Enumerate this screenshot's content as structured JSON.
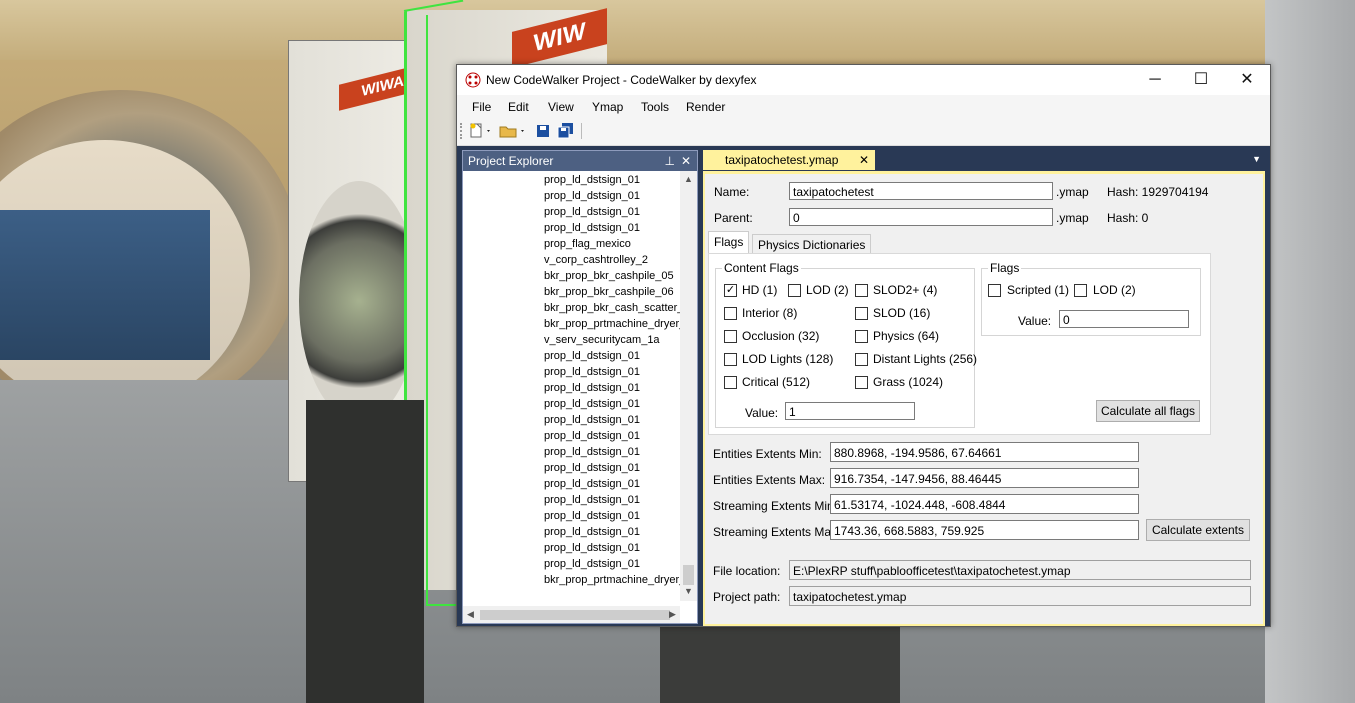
{
  "window": {
    "title": "New CodeWalker Project - CodeWalker by dexyfex",
    "controls": {
      "minimize": "─",
      "maximize": "☐",
      "close": "✕"
    }
  },
  "menu": [
    "File",
    "Edit",
    "View",
    "Ymap",
    "Tools",
    "Render"
  ],
  "explorer": {
    "title": "Project Explorer",
    "items": [
      "prop_ld_dstsign_01",
      "prop_ld_dstsign_01",
      "prop_ld_dstsign_01",
      "prop_ld_dstsign_01",
      "prop_flag_mexico",
      "v_corp_cashtrolley_2",
      "bkr_prop_bkr_cashpile_05",
      "bkr_prop_bkr_cashpile_06",
      "bkr_prop_bkr_cash_scatter_",
      "bkr_prop_prtmachine_dryer_",
      "v_serv_securitycam_1a",
      "prop_ld_dstsign_01",
      "prop_ld_dstsign_01",
      "prop_ld_dstsign_01",
      "prop_ld_dstsign_01",
      "prop_ld_dstsign_01",
      "prop_ld_dstsign_01",
      "prop_ld_dstsign_01",
      "prop_ld_dstsign_01",
      "prop_ld_dstsign_01",
      "prop_ld_dstsign_01",
      "prop_ld_dstsign_01",
      "prop_ld_dstsign_01",
      "prop_ld_dstsign_01",
      "prop_ld_dstsign_01",
      "bkr_prop_prtmachine_dryer_"
    ]
  },
  "document": {
    "tab_label": "taxipatochetest.ymap",
    "name_label": "Name:",
    "name_value": "taxipatochetest",
    "name_ext": ".ymap",
    "name_hash": "Hash: 1929704194",
    "parent_label": "Parent:",
    "parent_value": "0",
    "parent_ext": ".ymap",
    "parent_hash": "Hash: 0",
    "tabs": [
      "Flags",
      "Physics Dictionaries"
    ],
    "content_flags": {
      "title": "Content Flags",
      "items": [
        {
          "label": "HD (1)",
          "checked": true
        },
        {
          "label": "LOD (2)",
          "checked": false
        },
        {
          "label": "SLOD2+ (4)",
          "checked": false
        },
        {
          "label": "Interior (8)",
          "checked": false
        },
        {
          "label": "SLOD (16)",
          "checked": false
        },
        {
          "label": "Occlusion (32)",
          "checked": false
        },
        {
          "label": "Physics (64)",
          "checked": false
        },
        {
          "label": "LOD Lights (128)",
          "checked": false
        },
        {
          "label": "Distant Lights (256)",
          "checked": false
        },
        {
          "label": "Critical (512)",
          "checked": false
        },
        {
          "label": "Grass (1024)",
          "checked": false
        }
      ],
      "value_label": "Value:",
      "value": "1"
    },
    "flags": {
      "title": "Flags",
      "items": [
        {
          "label": "Scripted (1)",
          "checked": false
        },
        {
          "label": "LOD (2)",
          "checked": false
        }
      ],
      "value_label": "Value:",
      "value": "0"
    },
    "calc_flags_button": "Calculate all flags",
    "extents": {
      "entities_min_label": "Entities Extents Min:",
      "entities_min": "880.8968, -194.9586, 67.64661",
      "entities_max_label": "Entities Extents Max:",
      "entities_max": "916.7354, -147.9456, 88.46445",
      "streaming_min_label": "Streaming Extents Min:",
      "streaming_min": "61.53174, -1024.448, -608.4844",
      "streaming_max_label": "Streaming Extents Max:",
      "streaming_max": "1743.36, 668.5883, 759.925",
      "calc_button": "Calculate extents"
    },
    "file_location_label": "File location:",
    "file_location": "E:\\PlexRP stuff\\pabloofficetest\\taxipatochetest.ymap",
    "project_path_label": "Project path:",
    "project_path": "taxipatochetest.ymap"
  },
  "scene_signs": [
    "WIWANG",
    "WIW"
  ]
}
